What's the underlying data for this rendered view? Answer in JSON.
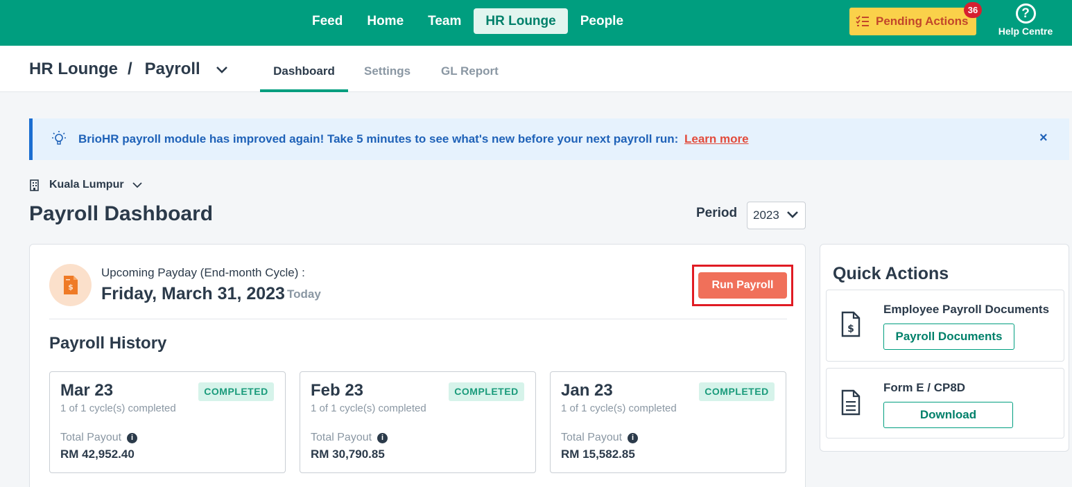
{
  "nav": {
    "items": [
      {
        "label": "Feed"
      },
      {
        "label": "Home"
      },
      {
        "label": "Team"
      },
      {
        "label": "HR Lounge",
        "active": true
      },
      {
        "label": "People"
      }
    ],
    "pending_label": "Pending Actions",
    "pending_count": "36",
    "help_label": "Help Centre"
  },
  "subheader": {
    "crumb_root": "HR Lounge",
    "crumb_sep": "/",
    "crumb_current": "Payroll",
    "tabs": [
      "Dashboard",
      "Settings",
      "GL Report"
    ]
  },
  "banner": {
    "message": "BrioHR payroll module has improved again! Take 5 minutes to see what's new before your next payroll run:",
    "link": "Learn more",
    "close": "×"
  },
  "location": "Kuala Lumpur",
  "page_title": "Payroll Dashboard",
  "period": {
    "label": "Period",
    "value": "2023"
  },
  "upcoming": {
    "label": "Upcoming Payday (End-month Cycle) :",
    "date": "Friday, March 31, 2023",
    "today": "Today",
    "run_button": "Run Payroll"
  },
  "history": {
    "title": "Payroll History",
    "cards": [
      {
        "month": "Mar 23",
        "cycles": "1 of 1 cycle(s) completed",
        "status": "COMPLETED",
        "payout_label": "Total Payout",
        "amount": "RM 42,952.40"
      },
      {
        "month": "Feb 23",
        "cycles": "1 of 1 cycle(s) completed",
        "status": "COMPLETED",
        "payout_label": "Total Payout",
        "amount": "RM 30,790.85"
      },
      {
        "month": "Jan 23",
        "cycles": "1 of 1 cycle(s) completed",
        "status": "COMPLETED",
        "payout_label": "Total Payout",
        "amount": "RM 15,582.85"
      }
    ]
  },
  "quick_actions": {
    "title": "Quick Actions",
    "items": [
      {
        "title": "Employee Payroll Documents",
        "button": "Payroll Documents"
      },
      {
        "title": "Form E / CP8D",
        "button": "Download"
      }
    ]
  },
  "colors": {
    "brand": "#009e7f",
    "run_button": "#f0705a",
    "pending": "#fad14a"
  }
}
